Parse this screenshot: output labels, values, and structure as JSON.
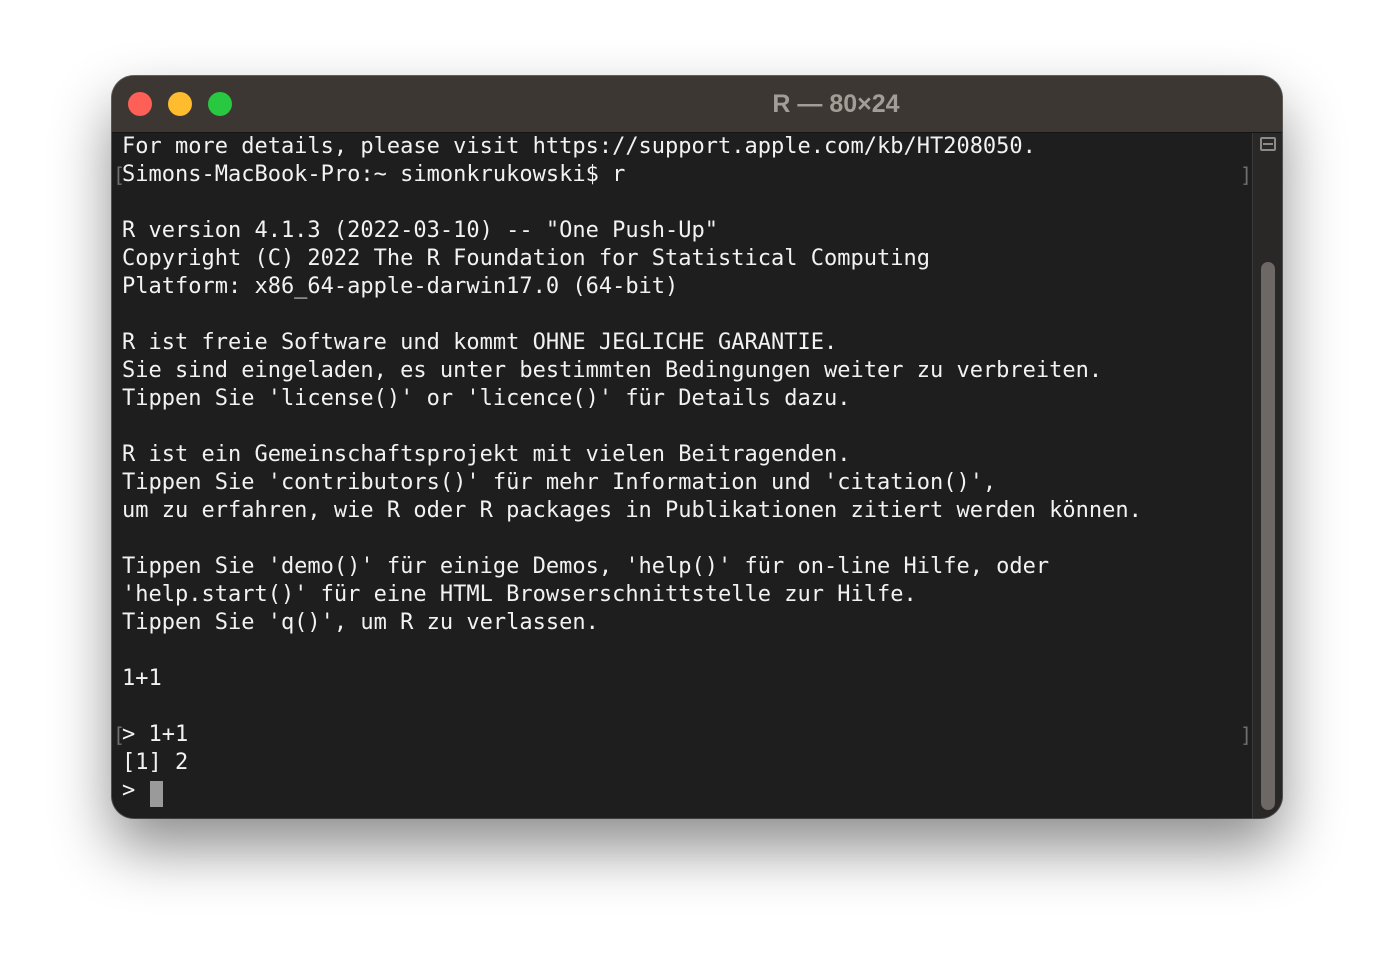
{
  "window": {
    "title": "R — 80×24"
  },
  "terminal": {
    "lines": [
      "For more details, please visit https://support.apple.com/kb/HT208050.",
      "Simons-MacBook-Pro:~ simonkrukowski$ r",
      "",
      "R version 4.1.3 (2022-03-10) -- \"One Push-Up\"",
      "Copyright (C) 2022 The R Foundation for Statistical Computing",
      "Platform: x86_64-apple-darwin17.0 (64-bit)",
      "",
      "R ist freie Software und kommt OHNE JEGLICHE GARANTIE.",
      "Sie sind eingeladen, es unter bestimmten Bedingungen weiter zu verbreiten.",
      "Tippen Sie 'license()' or 'licence()' für Details dazu.",
      "",
      "R ist ein Gemeinschaftsprojekt mit vielen Beitragenden.",
      "Tippen Sie 'contributors()' für mehr Information und 'citation()',",
      "um zu erfahren, wie R oder R packages in Publikationen zitiert werden können.",
      "",
      "Tippen Sie 'demo()' für einige Demos, 'help()' für on-line Hilfe, oder",
      "'help.start()' für eine HTML Browserschnittstelle zur Hilfe.",
      "Tippen Sie 'q()', um R zu verlassen.",
      "",
      "1+1",
      "",
      "> 1+1",
      "[1] 2",
      "> "
    ],
    "mark_left": "[",
    "mark_right": "]"
  }
}
